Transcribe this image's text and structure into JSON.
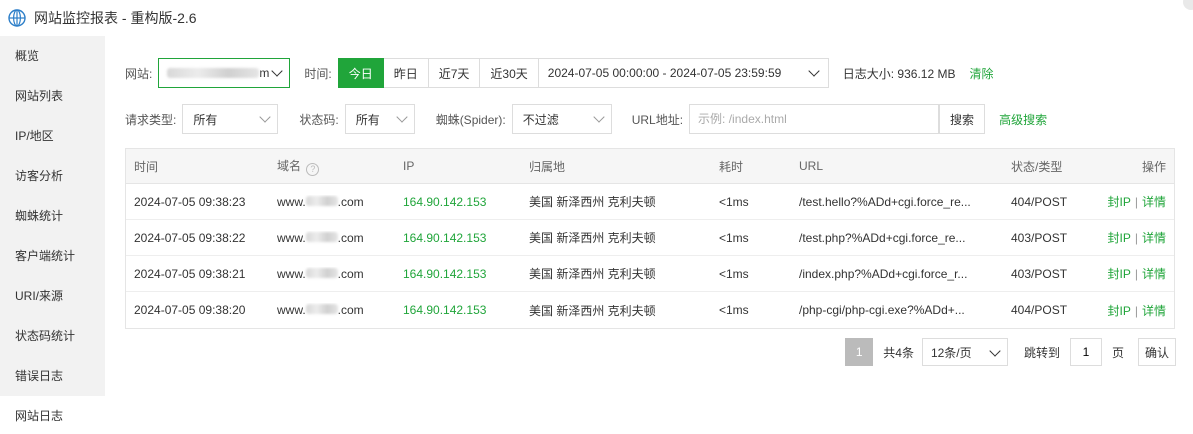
{
  "window": {
    "title": "网站监控报表 - 重构版-2.6"
  },
  "sidebar": {
    "items": [
      {
        "label": "概览"
      },
      {
        "label": "网站列表"
      },
      {
        "label": "IP/地区"
      },
      {
        "label": "访客分析"
      },
      {
        "label": "蜘蛛统计"
      },
      {
        "label": "客户端统计"
      },
      {
        "label": "URI/来源"
      },
      {
        "label": "状态码统计"
      },
      {
        "label": "错误日志"
      },
      {
        "label": "网站日志"
      }
    ]
  },
  "filters": {
    "site_label": "网站:",
    "site_value_suffix": "m",
    "time_label": "时间:",
    "time_buttons": [
      "今日",
      "昨日",
      "近7天",
      "近30天"
    ],
    "date_range": "2024-07-05 00:00:00 - 2024-07-05 23:59:59",
    "log_size": "日志大小:  936.12 MB",
    "clear_label": "清除",
    "req_type_label": "请求类型:",
    "req_type_value": "所有",
    "status_label": "状态码:",
    "status_value": "所有",
    "spider_label": "蜘蛛(Spider):",
    "spider_value": "不过滤",
    "url_label": "URL地址:",
    "url_placeholder": "示例: /index.html",
    "search_label": "搜索",
    "advanced_label": "高级搜索"
  },
  "table": {
    "headers": {
      "time": "时间",
      "domain": "域名",
      "help": "?",
      "ip": "IP",
      "location": "归属地",
      "cost": "耗时",
      "url": "URL",
      "status": "状态/类型",
      "op": "操作"
    },
    "rows": [
      {
        "time": "2024-07-05 09:38:23",
        "domain_prefix": "www.",
        "domain_suffix": ".com",
        "ip": "164.90.142.153",
        "location": "美国 新泽西州 克利夫顿",
        "cost": "<1ms",
        "url": "/test.hello?%ADd+cgi.force_re...",
        "status": "404/POST",
        "block": "封IP",
        "sep": "|",
        "detail": "详情"
      },
      {
        "time": "2024-07-05 09:38:22",
        "domain_prefix": "www.",
        "domain_suffix": ".com",
        "ip": "164.90.142.153",
        "location": "美国 新泽西州 克利夫顿",
        "cost": "<1ms",
        "url": "/test.php?%ADd+cgi.force_re...",
        "status": "403/POST",
        "block": "封IP",
        "sep": "|",
        "detail": "详情"
      },
      {
        "time": "2024-07-05 09:38:21",
        "domain_prefix": "www.",
        "domain_suffix": ".com",
        "ip": "164.90.142.153",
        "location": "美国 新泽西州 克利夫顿",
        "cost": "<1ms",
        "url": "/index.php?%ADd+cgi.force_r...",
        "status": "403/POST",
        "block": "封IP",
        "sep": "|",
        "detail": "详情"
      },
      {
        "time": "2024-07-05 09:38:20",
        "domain_prefix": "www.",
        "domain_suffix": ".com",
        "ip": "164.90.142.153",
        "location": "美国 新泽西州 克利夫顿",
        "cost": "<1ms",
        "url": "/php-cgi/php-cgi.exe?%ADd+...",
        "status": "404/POST",
        "block": "封IP",
        "sep": "|",
        "detail": "详情"
      }
    ]
  },
  "pager": {
    "current": "1",
    "total": "共4条",
    "page_size": "12条/页",
    "jump_label": "跳转到",
    "jump_value": "1",
    "page_unit": "页",
    "confirm": "确认"
  },
  "colors": {
    "accent": "#20a53a"
  },
  "icons": {
    "logo": "globe-icon",
    "help": "question-circle-icon",
    "dropdown": "chevron-down-icon"
  }
}
